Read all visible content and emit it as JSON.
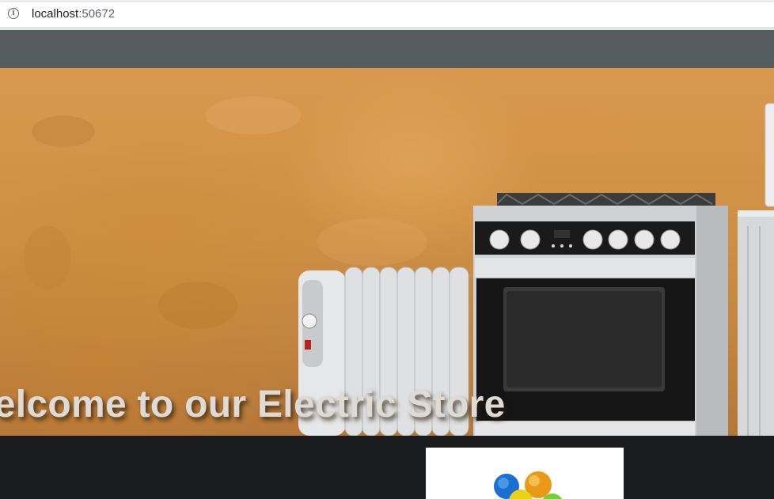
{
  "browser": {
    "url_host": "localhost",
    "url_port": ":50672",
    "info_icon": "info-icon"
  },
  "hero": {
    "title": "Welcome to our Electric Store"
  },
  "colors": {
    "navbar": "#545c60",
    "page_bg": "#1b1c1e",
    "hero_text": "#dedad6"
  }
}
